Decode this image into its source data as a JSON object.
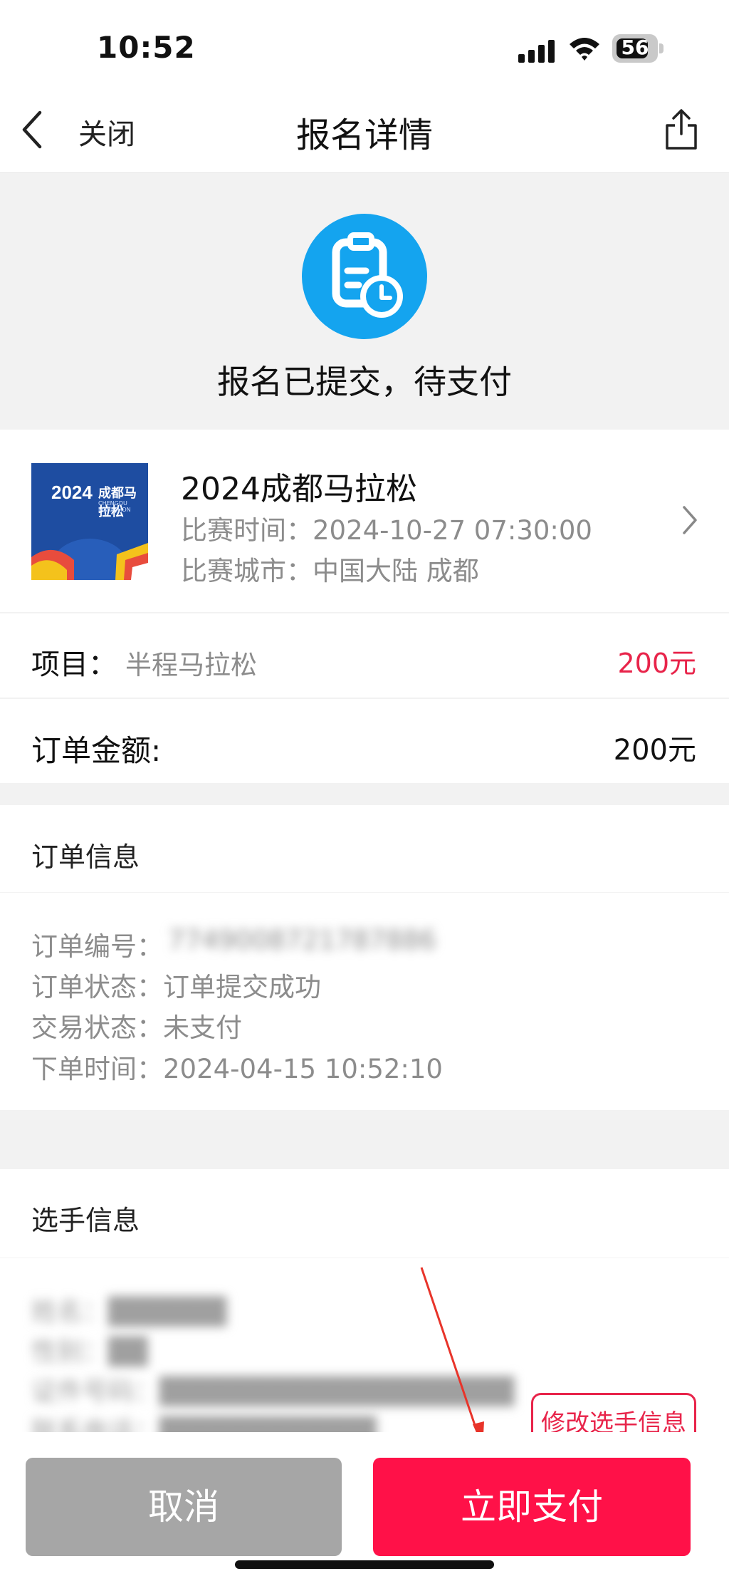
{
  "status_bar": {
    "time": "10:52",
    "battery": "56",
    "icons": [
      "signal-icon",
      "wifi-icon",
      "battery-icon"
    ]
  },
  "nav": {
    "back_icon": "chevron-left-icon",
    "close_label": "关闭",
    "title": "报名详情",
    "share_icon": "share-icon"
  },
  "hero": {
    "icon": "clipboard-clock-icon",
    "status_text": "报名已提交，待支付"
  },
  "race": {
    "thumbnail": {
      "year": "2024",
      "name": "成都马拉松",
      "subtitle": "CHENGDU MARATHON"
    },
    "title": "2024成都马拉松",
    "time_line": "比赛时间：2024-10-27 07:30:00",
    "city_line": "比赛城市：中国大陆 成都"
  },
  "project": {
    "label": "项目：",
    "value": "半程马拉松",
    "price": "200元"
  },
  "amount": {
    "label": "订单金额:",
    "value": "200元"
  },
  "order_info": {
    "title": "订单信息",
    "order_no_label": "订单编号：",
    "order_no_value": "7749008721787886",
    "order_status": "订单提交成功",
    "order_status_label": "订单状态：",
    "trade_status_label": "交易状态：",
    "trade_status": "未支付",
    "order_time_label": "下单时间：",
    "order_time": "2024-04-15 10:52:10"
  },
  "player_info": {
    "title": "选手信息",
    "name_line": "姓名：██████",
    "gender_line": "性别：██",
    "id_line": "证件号码：██████████████████",
    "phone_line": "联系电话：███████████",
    "edit_button": "修改选手信息"
  },
  "actions": {
    "cancel": "取消",
    "pay": "立即支付"
  },
  "colors": {
    "accent_red": "#ff1148",
    "price_red": "#e8244a",
    "hero_blue": "#14a4ef",
    "cancel_gray": "#a6a6a6"
  }
}
